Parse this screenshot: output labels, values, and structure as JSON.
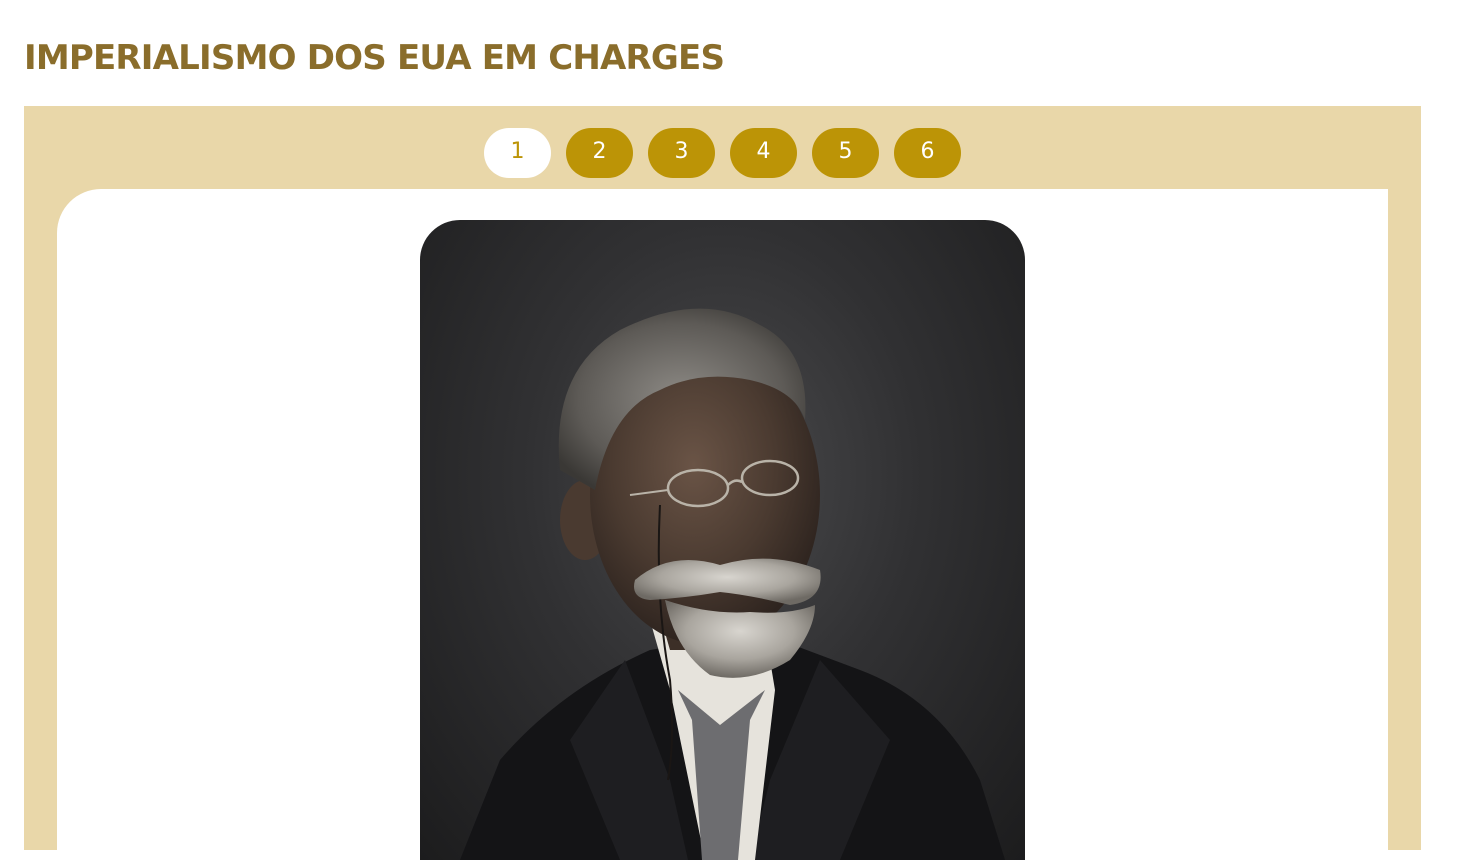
{
  "page": {
    "title": "IMPERIALISMO DOS EUA EM CHARGES"
  },
  "pagination": {
    "pages": [
      "1",
      "2",
      "3",
      "4",
      "5",
      "6"
    ],
    "active": "1"
  },
  "colors": {
    "title": "#8a6d2b",
    "panel_background": "#e9d7a9",
    "button_active_bg": "#ffffff",
    "button_bg": "#bc9406",
    "button_text": "#ffffff"
  }
}
